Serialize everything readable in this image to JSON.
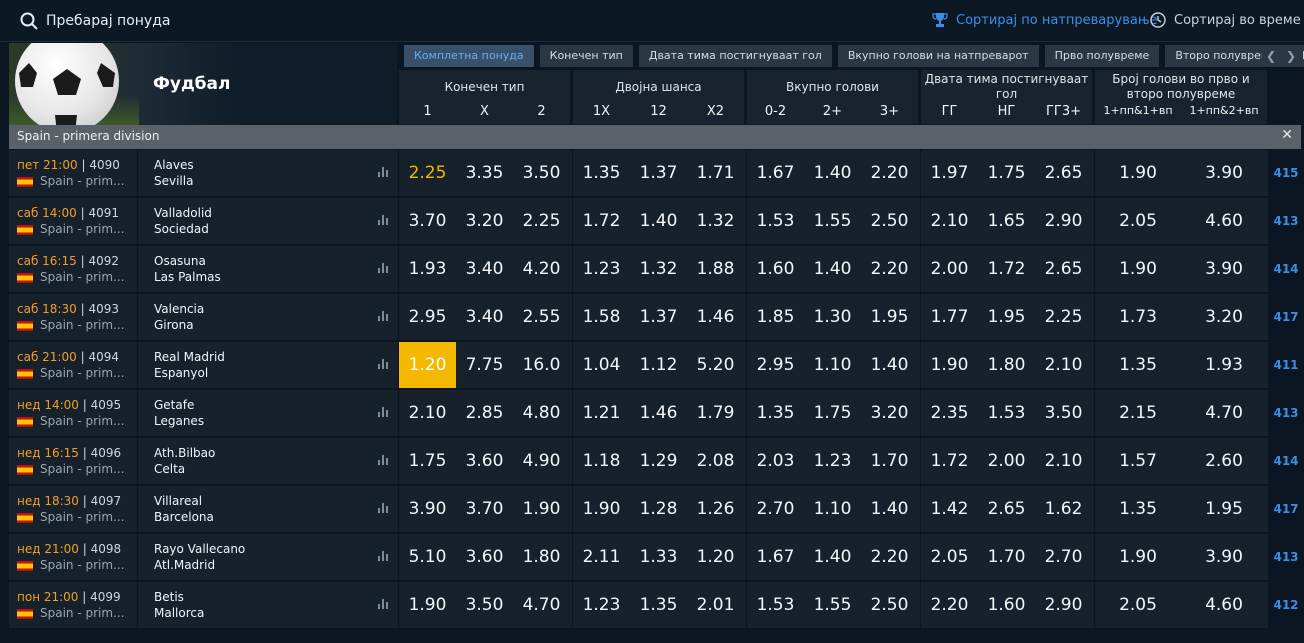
{
  "search": {
    "placeholder": "Пребарај понуда"
  },
  "sort": {
    "by_competition": "Сортирај по натпреварување",
    "by_time": "Сортирај во време"
  },
  "sport": {
    "title": "Фудбал"
  },
  "tabs": [
    "Комплетна понуда",
    "Конечен тип",
    "Двата тима постигнуваат гол",
    "Вкупно голови на натпреварот",
    "Прво полувреме",
    "Второ полувреме",
    "Голови"
  ],
  "groups": [
    {
      "title": "Конечен тип",
      "cols": [
        "1",
        "X",
        "2"
      ]
    },
    {
      "title": "Двојна шанса",
      "cols": [
        "1X",
        "12",
        "X2"
      ]
    },
    {
      "title": "Вкупно голови",
      "cols": [
        "0-2",
        "2+",
        "3+"
      ]
    },
    {
      "title": "Двата тима постигнуваат гол",
      "cols": [
        "ГГ",
        "НГ",
        "ГГ3+"
      ]
    },
    {
      "title": "Број голови во прво и второ полувреме",
      "cols": [
        "1+пп&1+вп",
        "1+пп&2+вп"
      ]
    }
  ],
  "league": {
    "name": "Spain - primera division"
  },
  "matches": [
    {
      "day_time": "пет 21:00",
      "code": "4090",
      "league": "Spain - prim...",
      "home": "Alaves",
      "away": "Sevilla",
      "odds": [
        "2.25",
        "3.35",
        "3.50",
        "1.35",
        "1.37",
        "1.71",
        "1.67",
        "1.40",
        "2.20",
        "1.97",
        "1.75",
        "2.65",
        "1.90",
        "3.90"
      ],
      "more": "415"
    },
    {
      "day_time": "саб 14:00",
      "code": "4091",
      "league": "Spain - prim...",
      "home": "Valladolid",
      "away": "Sociedad",
      "odds": [
        "3.70",
        "3.20",
        "2.25",
        "1.72",
        "1.40",
        "1.32",
        "1.53",
        "1.55",
        "2.50",
        "2.10",
        "1.65",
        "2.90",
        "2.05",
        "4.60"
      ],
      "more": "413"
    },
    {
      "day_time": "саб 16:15",
      "code": "4092",
      "league": "Spain - prim...",
      "home": "Osasuna",
      "away": "Las Palmas",
      "odds": [
        "1.93",
        "3.40",
        "4.20",
        "1.23",
        "1.32",
        "1.88",
        "1.60",
        "1.40",
        "2.20",
        "2.00",
        "1.72",
        "2.65",
        "1.90",
        "3.90"
      ],
      "more": "414"
    },
    {
      "day_time": "саб 18:30",
      "code": "4093",
      "league": "Spain - prim...",
      "home": "Valencia",
      "away": "Girona",
      "odds": [
        "2.95",
        "3.40",
        "2.55",
        "1.58",
        "1.37",
        "1.46",
        "1.85",
        "1.30",
        "1.95",
        "1.77",
        "1.95",
        "2.25",
        "1.73",
        "3.20"
      ],
      "more": "417"
    },
    {
      "day_time": "саб 21:00",
      "code": "4094",
      "league": "Spain - prim...",
      "home": "Real Madrid",
      "away": "Espanyol",
      "odds": [
        "1.20",
        "7.75",
        "16.0",
        "1.04",
        "1.12",
        "5.20",
        "2.95",
        "1.10",
        "1.40",
        "1.90",
        "1.80",
        "2.10",
        "1.35",
        "1.93"
      ],
      "more": "411"
    },
    {
      "day_time": "нед 14:00",
      "code": "4095",
      "league": "Spain - prim...",
      "home": "Getafe",
      "away": "Leganes",
      "odds": [
        "2.10",
        "2.85",
        "4.80",
        "1.21",
        "1.46",
        "1.79",
        "1.35",
        "1.75",
        "3.20",
        "2.35",
        "1.53",
        "3.50",
        "2.15",
        "4.70"
      ],
      "more": "413"
    },
    {
      "day_time": "нед 16:15",
      "code": "4096",
      "league": "Spain - prim...",
      "home": "Ath.Bilbao",
      "away": "Celta",
      "odds": [
        "1.75",
        "3.60",
        "4.90",
        "1.18",
        "1.29",
        "2.08",
        "2.03",
        "1.23",
        "1.70",
        "1.72",
        "2.00",
        "2.10",
        "1.57",
        "2.60"
      ],
      "more": "414"
    },
    {
      "day_time": "нед 18:30",
      "code": "4097",
      "league": "Spain - prim...",
      "home": "Villareal",
      "away": "Barcelona",
      "odds": [
        "3.90",
        "3.70",
        "1.90",
        "1.90",
        "1.28",
        "1.26",
        "2.70",
        "1.10",
        "1.40",
        "1.42",
        "2.65",
        "1.62",
        "1.35",
        "1.95"
      ],
      "more": "417"
    },
    {
      "day_time": "нед 21:00",
      "code": "4098",
      "league": "Spain - prim...",
      "home": "Rayo Vallecano",
      "away": "Atl.Madrid",
      "odds": [
        "5.10",
        "3.60",
        "1.80",
        "2.11",
        "1.33",
        "1.20",
        "1.67",
        "1.40",
        "2.20",
        "2.05",
        "1.70",
        "2.70",
        "1.90",
        "3.90"
      ],
      "more": "413"
    },
    {
      "day_time": "пон 21:00",
      "code": "4099",
      "league": "Spain - prim...",
      "home": "Betis",
      "away": "Mallorca",
      "odds": [
        "1.90",
        "3.50",
        "4.70",
        "1.23",
        "1.35",
        "2.01",
        "1.53",
        "1.55",
        "2.50",
        "2.20",
        "1.60",
        "2.90",
        "2.05",
        "4.60"
      ],
      "more": "412"
    }
  ],
  "highlight": {
    "selected_cell": "1.20",
    "accent": "#f5b800",
    "link": "#3a8ee6"
  }
}
